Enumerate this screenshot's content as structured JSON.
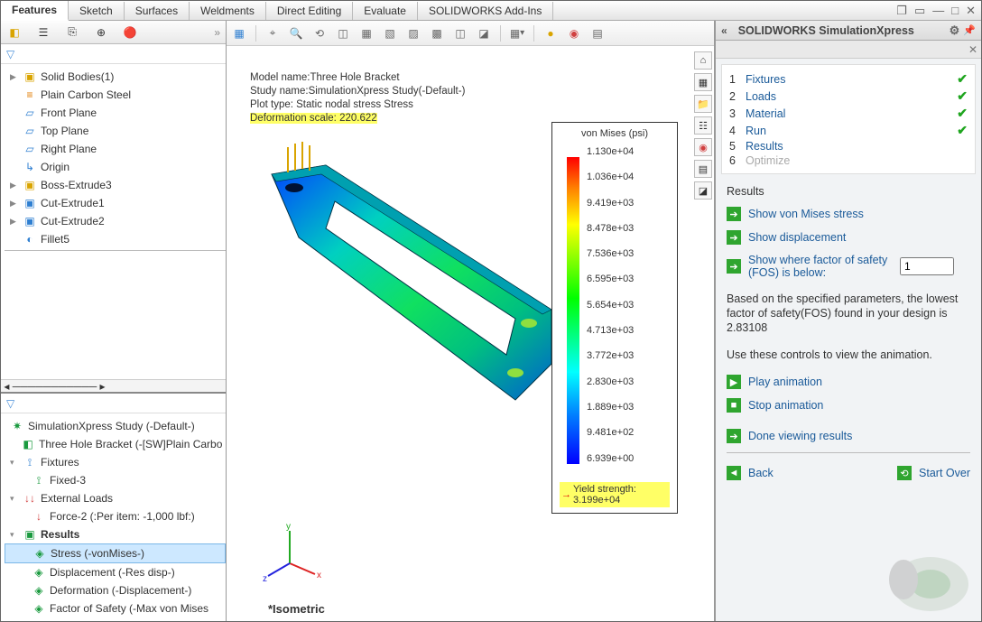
{
  "menubar": {
    "tabs": [
      "Features",
      "Sketch",
      "Surfaces",
      "Weldments",
      "Direct Editing",
      "Evaluate",
      "SOLIDWORKS Add-Ins"
    ]
  },
  "tree": {
    "items": [
      {
        "icon": "cube",
        "label": "Solid Bodies(1)",
        "caret": "▶"
      },
      {
        "icon": "mat",
        "label": "Plain Carbon Steel"
      },
      {
        "icon": "plane",
        "label": "Front Plane"
      },
      {
        "icon": "plane",
        "label": "Top Plane"
      },
      {
        "icon": "plane",
        "label": "Right Plane"
      },
      {
        "icon": "origin",
        "label": "Origin"
      },
      {
        "icon": "feat",
        "label": "Boss-Extrude3",
        "caret": "▶"
      },
      {
        "icon": "feat",
        "label": "Cut-Extrude1",
        "caret": "▶"
      },
      {
        "icon": "feat",
        "label": "Cut-Extrude2",
        "caret": "▶"
      },
      {
        "icon": "fillet",
        "label": "Fillet5"
      }
    ]
  },
  "study": {
    "name": "SimulationXpress Study (-Default-)",
    "part": "Three Hole Bracket (-[SW]Plain Carbo",
    "fixtures": {
      "label": "Fixtures",
      "child": "Fixed-3"
    },
    "loads": {
      "label": "External Loads",
      "child": "Force-2 (:Per item: -1,000 lbf:)"
    },
    "results": {
      "label": "Results",
      "items": [
        "Stress (-vonMises-)",
        "Displacement (-Res disp-)",
        "Deformation (-Displacement-)",
        "Factor of Safety (-Max von Mises"
      ]
    }
  },
  "meta": {
    "l1": "Model name:Three Hole Bracket",
    "l2": "Study name:SimulationXpress Study(-Default-)",
    "l3": "Plot type: Static nodal stress Stress",
    "l4": "Deformation scale: 220.622"
  },
  "legend": {
    "title": "von Mises (psi)",
    "ticks": [
      "1.130e+04",
      "1.036e+04",
      "9.419e+03",
      "8.478e+03",
      "7.536e+03",
      "6.595e+03",
      "5.654e+03",
      "4.713e+03",
      "3.772e+03",
      "2.830e+03",
      "1.889e+03",
      "9.481e+02",
      "6.939e+00"
    ],
    "yield": "Yield strength: 3.199e+04"
  },
  "iso": "*Isometric",
  "rp": {
    "title": "SOLIDWORKS SimulationXpress",
    "steps": [
      {
        "n": "1",
        "label": "Fixtures",
        "done": true
      },
      {
        "n": "2",
        "label": "Loads",
        "done": true
      },
      {
        "n": "3",
        "label": "Material",
        "done": true
      },
      {
        "n": "4",
        "label": "Run",
        "done": true
      },
      {
        "n": "5",
        "label": "Results"
      },
      {
        "n": "6",
        "label": "Optimize",
        "dim": true
      }
    ],
    "section": "Results",
    "a1": "Show von Mises stress",
    "a2": "Show displacement",
    "a3": "Show where factor of safety (FOS) is below:",
    "fosval": "1",
    "note1": "Based on the specified parameters, the lowest factor of safety(FOS) found in your design is 2.83108",
    "note2": "Use these controls to view the animation.",
    "play": "Play animation",
    "stop": "Stop animation",
    "done": "Done viewing results",
    "back": "Back",
    "start": "Start Over"
  }
}
